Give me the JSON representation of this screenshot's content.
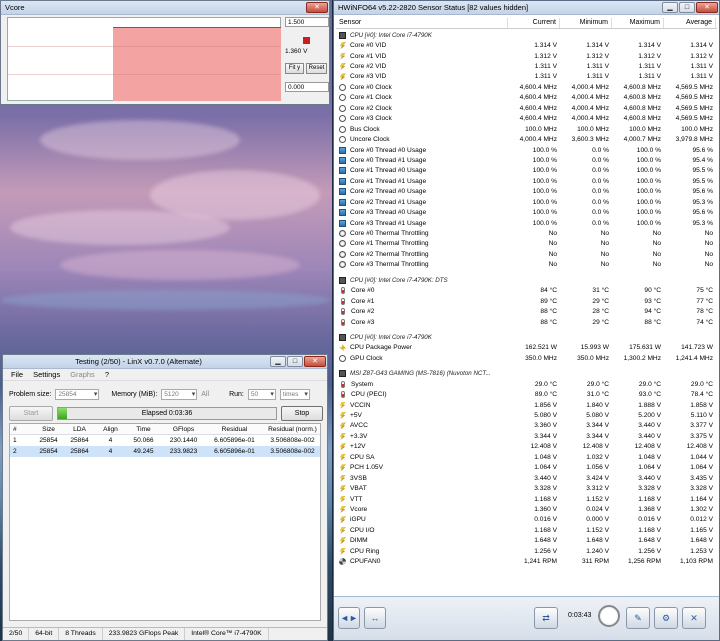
{
  "vcore": {
    "title": "Vcore",
    "max": "1.500",
    "current": "1.360 V",
    "min": "0.000",
    "fit_label": "Fit y",
    "reset_label": "Reset"
  },
  "linx": {
    "title": "Testing (2/50) - LinX v0.7.0 (Alternate)",
    "menu": [
      "File",
      "Settings",
      "Graphs",
      "?"
    ],
    "problem_size_label": "Problem size:",
    "problem_size": "25854",
    "memory_label": "Memory (MiB):",
    "memory": "5120",
    "memory_all": "All",
    "run_label": "Run:",
    "run": "50",
    "run_unit": "times",
    "start_label": "Start",
    "stop_label": "Stop",
    "elapsed": "Elapsed 0:03:36",
    "progress": 0.04,
    "columns": [
      "#",
      "Size",
      "LDA",
      "Align",
      "Time",
      "GFlops",
      "Residual",
      "Residual (norm.)"
    ],
    "rows": [
      [
        "1",
        "25854",
        "25864",
        "4",
        "50.066",
        "230.1440",
        "6.605896e-01",
        "3.506808e-002"
      ],
      [
        "2",
        "25854",
        "25864",
        "4",
        "49.245",
        "233.9823",
        "6.605896e-01",
        "3.506808e-002"
      ]
    ],
    "status": [
      "2/50",
      "64-bit",
      "8 Threads",
      "233.9823 GFlops Peak",
      "Intel® Core™ i7-4790K"
    ]
  },
  "hwinfo": {
    "title": "HWiNFO64 v5.22-2820 Sensor Status [82 values hidden]",
    "columns": [
      "Sensor",
      "Current",
      "Minimum",
      "Maximum",
      "Average"
    ],
    "elapsed": "0:03:43",
    "rows": [
      {
        "type": "grp",
        "name": "CPU [#0]: Intel Core i7-4790K"
      },
      {
        "icon": "volt",
        "name": "Core #0 VID",
        "cur": "1.314 V",
        "min": "1.314 V",
        "max": "1.314 V",
        "avg": "1.314 V"
      },
      {
        "icon": "volt",
        "name": "Core #1 VID",
        "cur": "1.312 V",
        "min": "1.312 V",
        "max": "1.312 V",
        "avg": "1.312 V"
      },
      {
        "icon": "volt",
        "name": "Core #2 VID",
        "cur": "1.311 V",
        "min": "1.311 V",
        "max": "1.311 V",
        "avg": "1.311 V"
      },
      {
        "icon": "volt",
        "name": "Core #3 VID",
        "cur": "1.311 V",
        "min": "1.311 V",
        "max": "1.311 V",
        "avg": "1.311 V"
      },
      {
        "icon": "clk",
        "name": "Core #0 Clock",
        "cur": "4,600.4 MHz",
        "min": "4,000.4 MHz",
        "max": "4,600.8 MHz",
        "avg": "4,569.5 MHz"
      },
      {
        "icon": "clk",
        "name": "Core #1 Clock",
        "cur": "4,600.4 MHz",
        "min": "4,000.4 MHz",
        "max": "4,600.8 MHz",
        "avg": "4,569.5 MHz"
      },
      {
        "icon": "clk",
        "name": "Core #2 Clock",
        "cur": "4,600.4 MHz",
        "min": "4,000.4 MHz",
        "max": "4,600.8 MHz",
        "avg": "4,569.5 MHz"
      },
      {
        "icon": "clk",
        "name": "Core #3 Clock",
        "cur": "4,600.4 MHz",
        "min": "4,000.4 MHz",
        "max": "4,600.8 MHz",
        "avg": "4,569.5 MHz"
      },
      {
        "icon": "clk",
        "name": "Bus Clock",
        "cur": "100.0 MHz",
        "min": "100.0 MHz",
        "max": "100.0 MHz",
        "avg": "100.0 MHz"
      },
      {
        "icon": "clk",
        "name": "Uncore Clock",
        "cur": "4,000.4 MHz",
        "min": "3,600.3 MHz",
        "max": "4,000.7 MHz",
        "avg": "3,979.8 MHz"
      },
      {
        "icon": "usage",
        "name": "Core #0 Thread #0 Usage",
        "cur": "100.0 %",
        "min": "0.0 %",
        "max": "100.0 %",
        "avg": "95.6 %"
      },
      {
        "icon": "usage",
        "name": "Core #0 Thread #1 Usage",
        "cur": "100.0 %",
        "min": "0.0 %",
        "max": "100.0 %",
        "avg": "95.4 %"
      },
      {
        "icon": "usage",
        "name": "Core #1 Thread #0 Usage",
        "cur": "100.0 %",
        "min": "0.0 %",
        "max": "100.0 %",
        "avg": "95.5 %"
      },
      {
        "icon": "usage",
        "name": "Core #1 Thread #1 Usage",
        "cur": "100.0 %",
        "min": "0.0 %",
        "max": "100.0 %",
        "avg": "95.5 %"
      },
      {
        "icon": "usage",
        "name": "Core #2 Thread #0 Usage",
        "cur": "100.0 %",
        "min": "0.0 %",
        "max": "100.0 %",
        "avg": "95.6 %"
      },
      {
        "icon": "usage",
        "name": "Core #2 Thread #1 Usage",
        "cur": "100.0 %",
        "min": "0.0 %",
        "max": "100.0 %",
        "avg": "95.3 %"
      },
      {
        "icon": "usage",
        "name": "Core #3 Thread #0 Usage",
        "cur": "100.0 %",
        "min": "0.0 %",
        "max": "100.0 %",
        "avg": "95.6 %"
      },
      {
        "icon": "usage",
        "name": "Core #3 Thread #1 Usage",
        "cur": "100.0 %",
        "min": "0.0 %",
        "max": "100.0 %",
        "avg": "95.3 %"
      },
      {
        "icon": "bool",
        "name": "Core #0 Thermal Throttling",
        "cur": "No",
        "min": "No",
        "max": "No",
        "avg": "No"
      },
      {
        "icon": "bool",
        "name": "Core #1 Thermal Throttling",
        "cur": "No",
        "min": "No",
        "max": "No",
        "avg": "No"
      },
      {
        "icon": "bool",
        "name": "Core #2 Thermal Throttling",
        "cur": "No",
        "min": "No",
        "max": "No",
        "avg": "No"
      },
      {
        "icon": "bool",
        "name": "Core #3 Thermal Throttling",
        "cur": "No",
        "min": "No",
        "max": "No",
        "avg": "No"
      },
      {
        "type": "blank"
      },
      {
        "type": "grp",
        "name": "CPU [#0]: Intel Core i7-4790K: DTS"
      },
      {
        "icon": "therm",
        "name": "Core #0",
        "cur": "84 °C",
        "min": "31 °C",
        "max": "90 °C",
        "avg": "75 °C"
      },
      {
        "icon": "therm",
        "name": "Core #1",
        "cur": "89 °C",
        "min": "29 °C",
        "max": "93 °C",
        "avg": "77 °C"
      },
      {
        "icon": "therm",
        "name": "Core #2",
        "cur": "88 °C",
        "min": "28 °C",
        "max": "94 °C",
        "avg": "78 °C"
      },
      {
        "icon": "therm",
        "name": "Core #3",
        "cur": "88 °C",
        "min": "29 °C",
        "max": "88 °C",
        "avg": "74 °C"
      },
      {
        "type": "blank"
      },
      {
        "type": "grp",
        "name": "CPU [#0]: Intel Core i7-4790K"
      },
      {
        "icon": "power",
        "name": "CPU Package Power",
        "cur": "162.521 W",
        "min": "15.993 W",
        "max": "175.631 W",
        "avg": "141.723 W"
      },
      {
        "icon": "clk",
        "name": "GPU Clock",
        "cur": "350.0 MHz",
        "min": "350.0 MHz",
        "max": "1,300.2 MHz",
        "avg": "1,241.4 MHz"
      },
      {
        "type": "blank"
      },
      {
        "type": "grp",
        "name": "MSI Z87-G43 GAMING (MS-7816) (Nuvoton NCT..."
      },
      {
        "icon": "therm",
        "name": "System",
        "cur": "29.0 °C",
        "min": "29.0 °C",
        "max": "29.0 °C",
        "avg": "29.0 °C"
      },
      {
        "icon": "therm",
        "name": "CPU (PECI)",
        "cur": "89.0 °C",
        "min": "31.0 °C",
        "max": "93.0 °C",
        "avg": "78.4 °C"
      },
      {
        "icon": "volt",
        "name": "VCCIN",
        "cur": "1.856 V",
        "min": "1.840 V",
        "max": "1.888 V",
        "avg": "1.858 V"
      },
      {
        "icon": "volt",
        "name": "+5V",
        "cur": "5.080 V",
        "min": "5.080 V",
        "max": "5.200 V",
        "avg": "5.110 V"
      },
      {
        "icon": "volt",
        "name": "AVCC",
        "cur": "3.360 V",
        "min": "3.344 V",
        "max": "3.440 V",
        "avg": "3.377 V"
      },
      {
        "icon": "volt",
        "name": "+3.3V",
        "cur": "3.344 V",
        "min": "3.344 V",
        "max": "3.440 V",
        "avg": "3.375 V"
      },
      {
        "icon": "volt",
        "name": "+12V",
        "cur": "12.408 V",
        "min": "12.408 V",
        "max": "12.408 V",
        "avg": "12.408 V"
      },
      {
        "icon": "volt",
        "name": "CPU SA",
        "cur": "1.048 V",
        "min": "1.032 V",
        "max": "1.048 V",
        "avg": "1.044 V"
      },
      {
        "icon": "volt",
        "name": "PCH 1.05V",
        "cur": "1.064 V",
        "min": "1.056 V",
        "max": "1.064 V",
        "avg": "1.064 V"
      },
      {
        "icon": "volt",
        "name": "3VSB",
        "cur": "3.440 V",
        "min": "3.424 V",
        "max": "3.440 V",
        "avg": "3.435 V"
      },
      {
        "icon": "volt",
        "name": "VBAT",
        "cur": "3.328 V",
        "min": "3.312 V",
        "max": "3.328 V",
        "avg": "3.328 V"
      },
      {
        "icon": "volt",
        "name": "VTT",
        "cur": "1.168 V",
        "min": "1.152 V",
        "max": "1.168 V",
        "avg": "1.164 V"
      },
      {
        "icon": "volt",
        "name": "Vcore",
        "cur": "1.360 V",
        "min": "0.024 V",
        "max": "1.368 V",
        "avg": "1.302 V"
      },
      {
        "icon": "volt",
        "name": "iGPU",
        "cur": "0.016 V",
        "min": "0.000 V",
        "max": "0.016 V",
        "avg": "0.012 V"
      },
      {
        "icon": "volt",
        "name": "CPU I/O",
        "cur": "1.168 V",
        "min": "1.152 V",
        "max": "1.168 V",
        "avg": "1.165 V"
      },
      {
        "icon": "volt",
        "name": "DIMM",
        "cur": "1.648 V",
        "min": "1.648 V",
        "max": "1.648 V",
        "avg": "1.648 V"
      },
      {
        "icon": "volt",
        "name": "CPU Ring",
        "cur": "1.256 V",
        "min": "1.240 V",
        "max": "1.256 V",
        "avg": "1.253 V"
      },
      {
        "icon": "fan",
        "name": "CPUFAN0",
        "cur": "1,241 RPM",
        "min": "311 RPM",
        "max": "1,256 RPM",
        "avg": "1,103 RPM"
      }
    ]
  }
}
